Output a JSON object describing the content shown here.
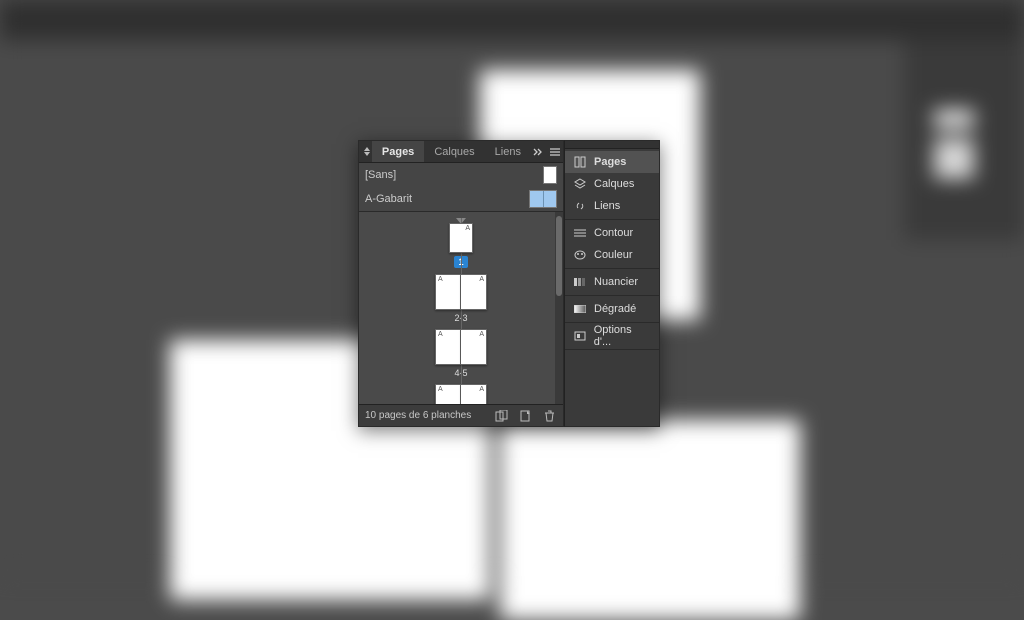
{
  "tabs": {
    "pages": "Pages",
    "calques": "Calques",
    "liens": "Liens"
  },
  "masters": {
    "none": "[Sans]",
    "a": "A-Gabarit"
  },
  "page_markers": {
    "a": "A"
  },
  "page_numbers": {
    "p1": "1",
    "p2_3": "2-3",
    "p4_5": "4-5"
  },
  "footer": {
    "status": "10 pages de 6 planches"
  },
  "dock": {
    "pages": "Pages",
    "calques": "Calques",
    "liens": "Liens",
    "contour": "Contour",
    "couleur": "Couleur",
    "nuancier": "Nuancier",
    "degrade": "Dégradé",
    "options": "Options d'..."
  }
}
